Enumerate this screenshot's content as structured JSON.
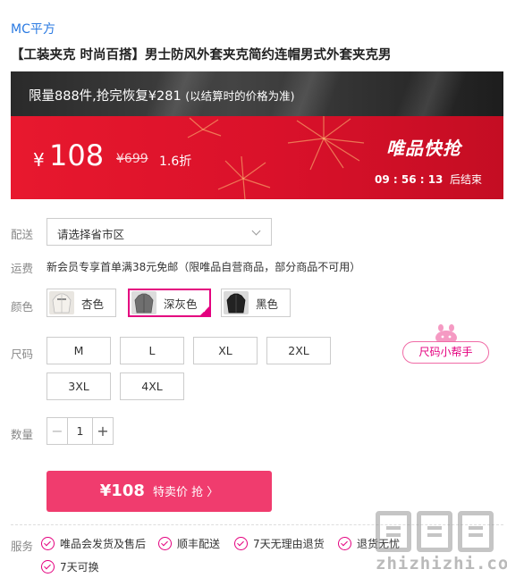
{
  "brand": "MC平方",
  "product_title": "【工装夹克 时尚百搭】男士防风外套夹克简约连帽男式外套夹克男",
  "promo": {
    "notice_main": "限量888件,抢完恢复¥281",
    "notice_sub": "(以结算时的价格为准)",
    "currency": "¥",
    "price": "108",
    "original_price": "¥699",
    "discount": "1.6折",
    "badge": "唯品快抢",
    "countdown": "09 : 56 : 13",
    "countdown_suffix": "后结束",
    "colors": {
      "top_bar": "#2a2a2a",
      "red": "#e8182e"
    }
  },
  "delivery": {
    "label": "配送",
    "placeholder": "请选择省市区"
  },
  "shipping": {
    "label": "运费",
    "text": "新会员专享首单满38元免邮（限唯品自营商品，部分商品不可用）"
  },
  "color": {
    "label": "颜色",
    "options": [
      {
        "name": "杏色",
        "selected": false
      },
      {
        "name": "深灰色",
        "selected": true
      },
      {
        "name": "黑色",
        "selected": false
      }
    ]
  },
  "size": {
    "label": "尺码",
    "options": [
      "M",
      "L",
      "XL",
      "2XL",
      "3XL",
      "4XL"
    ],
    "helper": "尺码小帮手"
  },
  "quantity": {
    "label": "数量",
    "value": "1",
    "minus": "−",
    "plus": "+"
  },
  "buy_button": {
    "price": "¥108",
    "text": "特卖价 抢 〉"
  },
  "services": {
    "label": "服务",
    "items": [
      "唯品会发货及售后",
      "顺丰配送",
      "7天无理由退货",
      "退货无忧",
      "7天可换"
    ]
  },
  "watermark": {
    "text": "zhizhizhi.com"
  },
  "accent_color": "#e4007f",
  "button_color": "#f03c6e"
}
